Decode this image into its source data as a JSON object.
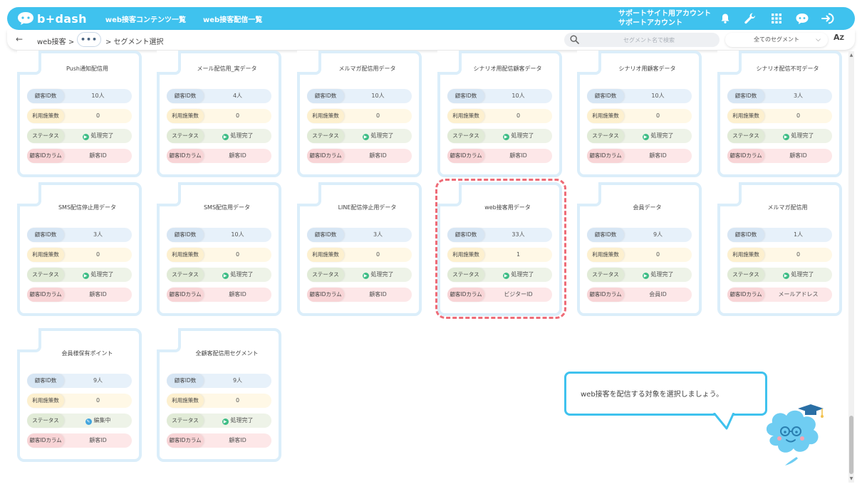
{
  "header": {
    "logo_text": "b+dash",
    "nav": [
      "web接客コンテンツ一覧",
      "web接客配信一覧"
    ],
    "account_line1": "サポートサイト用アカウント",
    "account_line2": "サポートアカウント",
    "icons": [
      "bell-icon",
      "wrench-icon",
      "apps-grid-icon",
      "chat-robot-icon",
      "logout-icon"
    ]
  },
  "subheader": {
    "back_glyph": "←",
    "crumb_root": "web接客 >",
    "ellipsis": "•••",
    "crumb_current": "> セグメント選択",
    "search_placeholder": "セグメント名で検索",
    "filter_value": "全てのセグメント",
    "sort_label": "A",
    "sort_label2": "Z"
  },
  "labels": {
    "customer_count": "顧客ID数",
    "usage_count": "利用施策数",
    "status": "ステータス",
    "id_column": "顧客IDカラム"
  },
  "cards": [
    {
      "title": "Push通知配信用",
      "count": "10人",
      "usage": "0",
      "status": "処理完了",
      "status_type": "done",
      "column": "顧客ID"
    },
    {
      "title": "メール配信用_実データ",
      "count": "4人",
      "usage": "0",
      "status": "処理完了",
      "status_type": "done",
      "column": "顧客ID"
    },
    {
      "title": "メルマガ配信用データ",
      "count": "10人",
      "usage": "0",
      "status": "処理完了",
      "status_type": "done",
      "column": "顧客ID"
    },
    {
      "title": "シナリオ用配信顧客データ",
      "count": "10人",
      "usage": "0",
      "status": "処理完了",
      "status_type": "done",
      "column": "顧客ID"
    },
    {
      "title": "シナリオ用顧客データ",
      "count": "10人",
      "usage": "0",
      "status": "処理完了",
      "status_type": "done",
      "column": "顧客ID"
    },
    {
      "title": "シナリオ配信不可データ",
      "count": "3人",
      "usage": "0",
      "status": "処理完了",
      "status_type": "done",
      "column": "顧客ID"
    },
    {
      "title": "SMS配信停止用データ",
      "count": "3人",
      "usage": "0",
      "status": "処理完了",
      "status_type": "done",
      "column": "顧客ID"
    },
    {
      "title": "SMS配信用データ",
      "count": "10人",
      "usage": "0",
      "status": "処理完了",
      "status_type": "done",
      "column": "顧客ID"
    },
    {
      "title": "LINE配信停止用データ",
      "count": "3人",
      "usage": "0",
      "status": "処理完了",
      "status_type": "done",
      "column": "顧客ID"
    },
    {
      "title": "web接客用データ",
      "count": "33人",
      "usage": "1",
      "status": "処理完了",
      "status_type": "done",
      "column": "ビジターID"
    },
    {
      "title": "会員データ",
      "count": "9人",
      "usage": "0",
      "status": "処理完了",
      "status_type": "done",
      "column": "会員ID"
    },
    {
      "title": "メルマガ配信用",
      "count": "1人",
      "usage": "0",
      "status": "処理完了",
      "status_type": "done",
      "column": "メールアドレス"
    },
    {
      "title": "会員様保有ポイント",
      "count": "9人",
      "usage": "0",
      "status": "編集中",
      "status_type": "edit",
      "column": "顧客ID"
    },
    {
      "title": "全顧客配信用セグメント",
      "count": "9人",
      "usage": "0",
      "status": "処理完了",
      "status_type": "done",
      "column": "顧客ID"
    }
  ],
  "hint": {
    "message": "web接客を配信する対象を選択しましょう。"
  },
  "colors": {
    "brand": "#3fc2ee",
    "highlight": "#ee6b77",
    "status_done": "#3dbd86",
    "status_edit": "#42a5de"
  }
}
